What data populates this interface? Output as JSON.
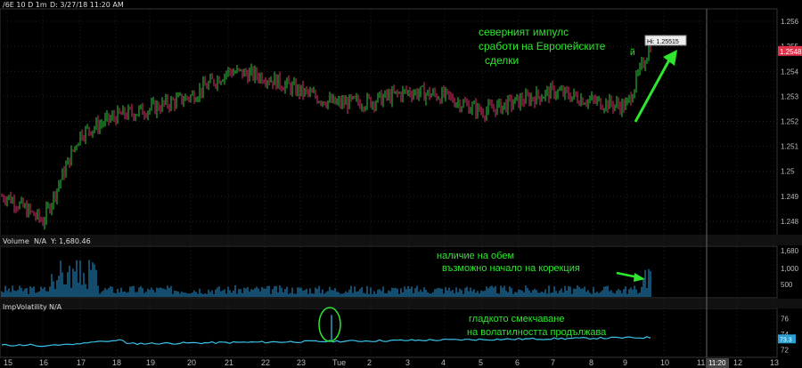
{
  "header": {
    "symbol": "/6E 10 D 1m",
    "date_info": "D: 3/27/18 11:20 AM"
  },
  "volume_panel": {
    "label": "Volume",
    "na": "N/A",
    "y_readout": "Y: 1,680.46",
    "ticks": [
      "1,680",
      "1,000",
      "500"
    ]
  },
  "impvol_panel": {
    "label": "ImpVolatility",
    "na": "N/A",
    "ticks": [
      "76",
      "74",
      "72"
    ],
    "last_value": "73.3"
  },
  "price_axis": {
    "ticks": [
      "1.256",
      "1.255",
      "1.254",
      "1.253",
      "1.252",
      "1.251",
      "1.25",
      "1.249",
      "1.248"
    ],
    "last_price": "1.2548",
    "hi_label": "Hi: 1.25515"
  },
  "time_axis": {
    "labels": [
      "15",
      "16",
      "17",
      "18",
      "19",
      "20",
      "21",
      "22",
      "23",
      "Tue",
      "2",
      "3",
      "4",
      "5",
      "6",
      "7",
      "8",
      "9",
      "10",
      "11",
      "12",
      "13"
    ],
    "cursor_time": "11:20"
  },
  "annotations": {
    "price_note_lines": [
      "северният импулс",
      "сработи на Европейските",
      "сделки"
    ],
    "price_note_extra": "й",
    "volume_note_lines": [
      "наличие на обем",
      "възможно начало на корекция"
    ],
    "impvol_note_lines": [
      "гладкото смекчаване",
      "на волатилността продължава"
    ]
  },
  "colors": {
    "background": "#000000",
    "up_candle": "#2ecc40",
    "down_candle": "#e0306a",
    "volume_bars": "#1d6e9e",
    "impvol_line": "#3ac3e8",
    "annotation": "#2ee62e",
    "last_price_tag": "#e0304a",
    "grid": "#222222"
  },
  "chart_data": {
    "type": "line",
    "title": "/6E 10 D 1m",
    "ylim": [
      1.2475,
      1.2565
    ],
    "x": [
      "15",
      "16",
      "17",
      "18",
      "19",
      "20",
      "21",
      "22",
      "23",
      "Tue",
      "2",
      "3",
      "4",
      "5",
      "6",
      "7",
      "8",
      "9",
      "10"
    ],
    "series": [
      {
        "values": [
          1.249,
          1.248,
          1.2515,
          1.2522,
          1.2525,
          1.253,
          1.254,
          1.2538,
          1.2532,
          1.2527,
          1.2528,
          1.2532,
          1.253,
          1.2524,
          1.2528,
          1.2532,
          1.2528,
          1.2526,
          1.2551
        ]
      }
    ]
  }
}
